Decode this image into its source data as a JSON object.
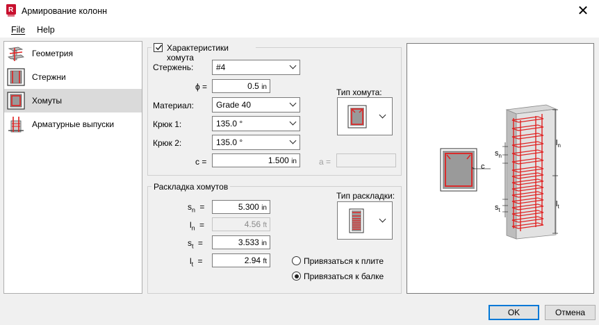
{
  "window": {
    "title": "Армирование колонн",
    "close_glyph": "✕"
  },
  "menu": {
    "file": "File",
    "help": "Help"
  },
  "nav": {
    "items": [
      {
        "label": "Геометрия",
        "icon": "geometry-icon",
        "selected": false
      },
      {
        "label": "Стержни",
        "icon": "bars-icon",
        "selected": false
      },
      {
        "label": "Хомуты",
        "icon": "ties-icon",
        "selected": true
      },
      {
        "label": "Арматурные выпуски",
        "icon": "dowels-icon",
        "selected": false
      }
    ]
  },
  "tie_props": {
    "checkbox_label": "Характеристики хомута",
    "checked": true,
    "bar_label": "Стержень:",
    "bar_value": "#4",
    "phi_label": "ϕ =",
    "phi_value": "0.5",
    "phi_unit": "in",
    "material_label": "Материал:",
    "material_value": "Grade 40",
    "hook1_label": "Крюк 1:",
    "hook1_value": "135.0 °",
    "hook2_label": "Крюк 2:",
    "hook2_value": "135.0 °",
    "c_label": "c =",
    "c_value": "1.500",
    "c_unit": "in",
    "a_label": "a =",
    "a_value": "",
    "tie_type_label": "Тип хомута:"
  },
  "layout": {
    "legend": "Раскладка хомутов",
    "sn_label_main": "s",
    "sn_label_sub": "n",
    "sn_eq": "=",
    "sn_value": "5.300",
    "sn_unit": "in",
    "ln_label_main": "l",
    "ln_label_sub": "n",
    "ln_eq": "=",
    "ln_value": "4.56",
    "ln_unit": "ft",
    "st_label_main": "s",
    "st_label_sub": "t",
    "st_eq": "=",
    "st_value": "3.533",
    "st_unit": "in",
    "lt_label_main": "l",
    "lt_label_sub": "t",
    "lt_eq": "=",
    "lt_value": "2.94",
    "lt_unit": "ft",
    "layout_type_label": "Тип раскладки:",
    "radio_slab": "Привязаться к плите",
    "radio_beam": "Привязаться к балке",
    "selected_radio": "beam"
  },
  "preview": {
    "c_label": "c",
    "sn_label": "s",
    "sn_sub": "n",
    "ln_label": "l",
    "ln_sub": "n",
    "st_label": "s",
    "st_sub": "t",
    "lt_label": "l",
    "lt_sub": "t"
  },
  "buttons": {
    "ok": "OK",
    "cancel": "Отмена"
  },
  "colors": {
    "accent": "#0078d7",
    "rebar": "#e02020",
    "app_icon": "#c8102e"
  }
}
